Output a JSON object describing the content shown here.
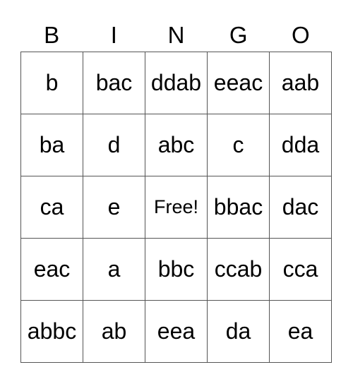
{
  "header": [
    "B",
    "I",
    "N",
    "G",
    "O"
  ],
  "rows": [
    [
      "b",
      "bac",
      "ddab",
      "eeac",
      "aab"
    ],
    [
      "ba",
      "d",
      "abc",
      "c",
      "dda"
    ],
    [
      "ca",
      "e",
      "Free!",
      "bbac",
      "dac"
    ],
    [
      "eac",
      "a",
      "bbc",
      "ccab",
      "cca"
    ],
    [
      "abbc",
      "ab",
      "eea",
      "da",
      "ea"
    ]
  ]
}
